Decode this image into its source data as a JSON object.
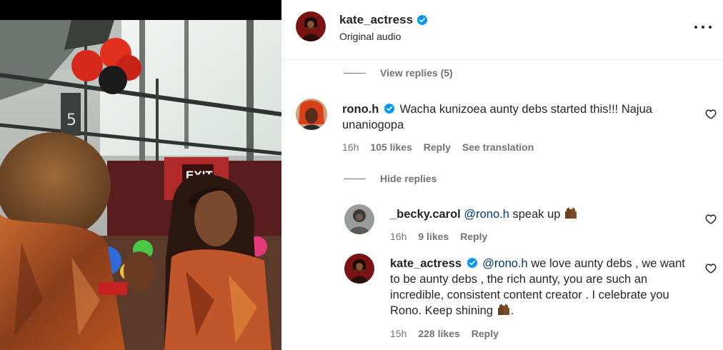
{
  "post": {
    "author": "kate_actress",
    "subtitle": "Original audio"
  },
  "replies_toggle_top": "View replies (5)",
  "comment_main": {
    "user": "rono.h",
    "text": "Wacha kunizoea aunty debs started this!!! Najua unaniogopa",
    "time": "16h",
    "likes": "105 likes",
    "reply_label": "Reply",
    "translation_label": "See translation"
  },
  "replies_toggle_bottom": "Hide replies",
  "reply_1": {
    "user": "_becky.carol",
    "mention": "@rono.h",
    "text": " speak up ",
    "time": "16h",
    "likes": "9 likes",
    "reply_label": "Reply"
  },
  "reply_2": {
    "user": "kate_actress",
    "mention": "@rono.h",
    "text": " we love aunty debs , we want to be aunty debs , the rich aunty, you are such an incredible, consistent content creator . I celebrate you Rono. Keep shining ",
    "text_end": ".",
    "time": "15h",
    "likes": "228 likes",
    "reply_label": "Reply"
  },
  "media": {
    "sign_text": "EXIT"
  },
  "colors": {
    "verified": "#0095f6",
    "secondary_text": "#737373",
    "mention": "#00376b"
  },
  "icons": {
    "verified": "verified-badge-icon",
    "more": "more-options-icon",
    "like": "heart-outline-icon",
    "emoji": "raised-hands-emoji"
  }
}
